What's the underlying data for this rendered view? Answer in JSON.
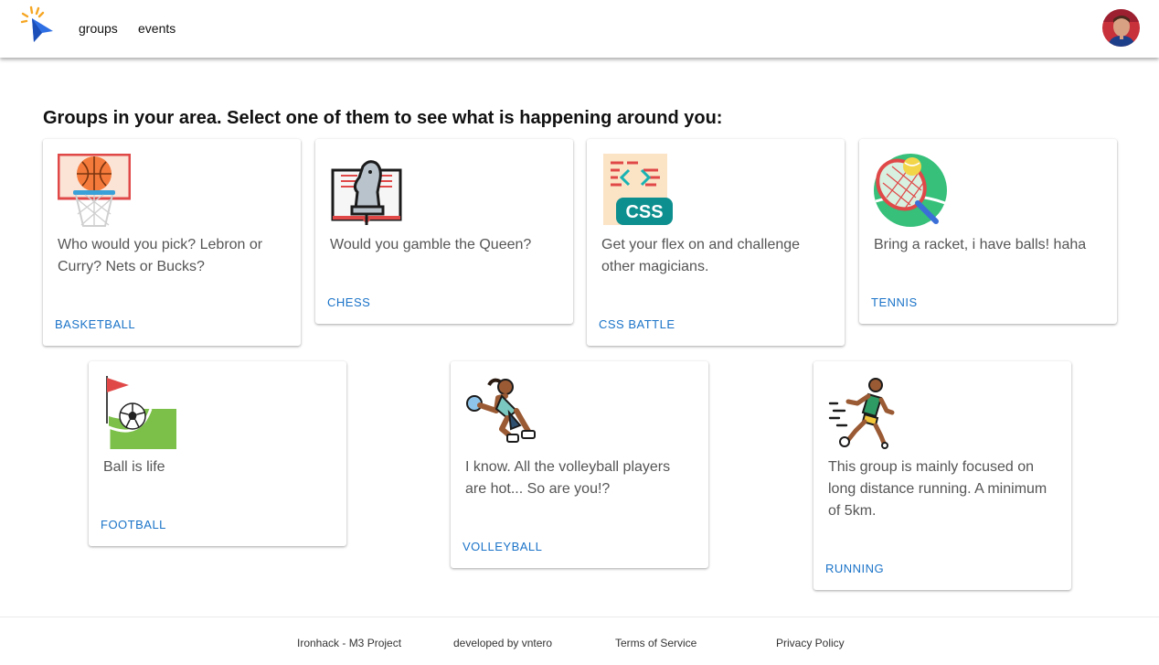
{
  "nav": {
    "groups_label": "groups",
    "events_label": "events"
  },
  "main": {
    "heading": "Groups in your area. Select one of them to see what is happening around you:"
  },
  "groups": [
    {
      "icon": "basketball-hoop-icon",
      "description": "Who would you pick? Lebron or Curry? Nets or Bucks?",
      "link_label": "BASKETBALL"
    },
    {
      "icon": "chess-knight-book-icon",
      "description": "Would you gamble the Queen?",
      "link_label": "CHESS"
    },
    {
      "icon": "css-file-icon",
      "description": "Get your flex on and challenge other magicians.",
      "link_label": "CSS BATTLE"
    },
    {
      "icon": "tennis-racket-icon",
      "description": "Bring a racket, i have balls! haha",
      "link_label": "TENNIS"
    },
    {
      "icon": "football-corner-flag-icon",
      "description": "Ball is life",
      "link_label": "FOOTBALL"
    },
    {
      "icon": "volleyball-player-icon",
      "description": "I know. All the volleyball players are hot... So are you!?",
      "link_label": "VOLLEYBALL"
    },
    {
      "icon": "runner-icon",
      "description": "This group is mainly focused on long distance running. A minimum of 5km.",
      "link_label": "RUNNING"
    }
  ],
  "footer": {
    "project": "Ironhack - M3 Project",
    "developer": "developed by vntero",
    "terms": "Terms of Service",
    "privacy": "Privacy Policy"
  },
  "colors": {
    "link": "#1a73c8",
    "logo_blue": "#2f6fe4",
    "logo_sparks": "#f6a623"
  }
}
